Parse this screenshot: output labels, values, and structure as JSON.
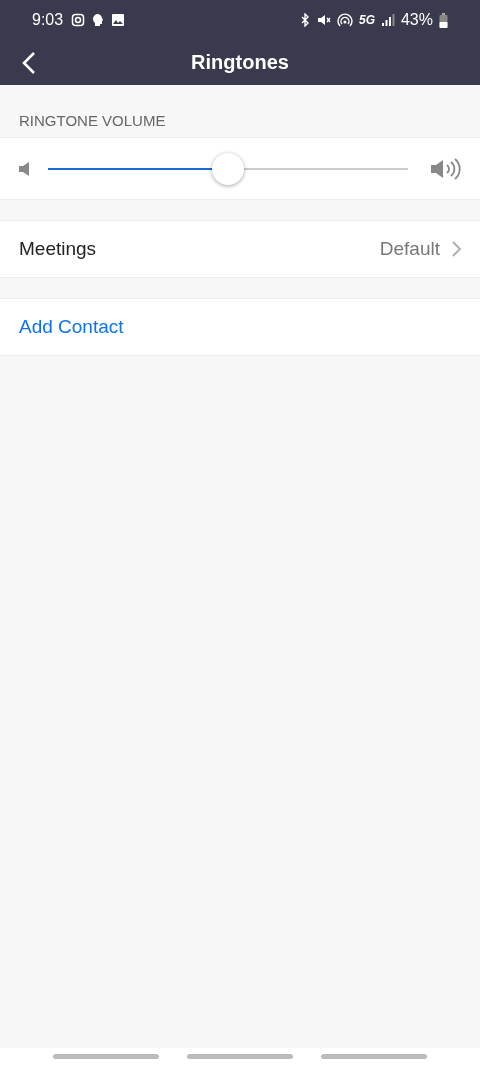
{
  "status_bar": {
    "time": "9:03",
    "battery": "43%",
    "network": "5G"
  },
  "header": {
    "title": "Ringtones"
  },
  "volume": {
    "label": "RINGTONE VOLUME",
    "level": 0.5
  },
  "rows": [
    {
      "kind": "setting",
      "label": "Meetings",
      "value": "Default"
    },
    {
      "kind": "link",
      "label": "Add Contact"
    }
  ]
}
